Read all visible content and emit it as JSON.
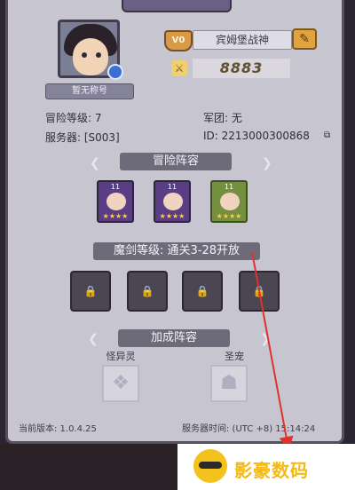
{
  "profile": {
    "nickname_placeholder": "暂无称号",
    "vip_label": "V0",
    "player_name": "宾姆堡战神",
    "power": "8883",
    "adventure_level": "冒险等级: 7",
    "legion": "军团: 无",
    "server": "服务器: [S003]",
    "id": "ID: 2213000300868"
  },
  "adventure_team": {
    "title": "冒险阵容",
    "heroes": [
      {
        "level": "11",
        "stars": "★★★★"
      },
      {
        "level": "11",
        "stars": "★★★★"
      },
      {
        "level": "11",
        "stars": "★★★★"
      }
    ]
  },
  "magic_sword": {
    "title": "魔剑等级: 通关3-28开放",
    "slots": [
      "🔒",
      "🔒",
      "🔒",
      "🔒"
    ]
  },
  "bonus_team": {
    "title": "加成阵容",
    "left_label": "怪异灵",
    "right_label": "圣宠"
  },
  "footer": {
    "version": "当前版本: 1.0.4.25",
    "server_time": "服务器时间: (UTC +8) 15:14:24"
  },
  "watermark": {
    "brand_text": "影豪数码"
  },
  "colors": {
    "panel_bg": "#c7c6d0",
    "arrow": "#e0312b",
    "accent_gold": "#e0a33e"
  }
}
